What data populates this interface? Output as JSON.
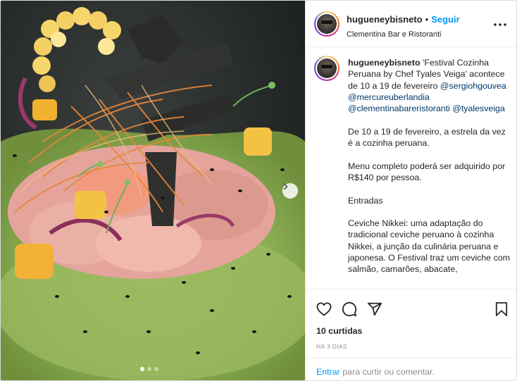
{
  "post": {
    "username": "hugueneybisneto",
    "bullet": "•",
    "follow_label": "Seguir",
    "location": "Clementina Bar e Ristoranti",
    "image_alt": "Prato de ceviche com milho, salmão, manga e molho verde",
    "carousel": {
      "count": 3,
      "active": 1
    }
  },
  "caption": {
    "username": "hugueneybisneto",
    "intro": "'Festival Cozinha Peruana by Chef Tyales Veiga' acontece de 10 a 19 de fevereiro",
    "mentions": [
      "@sergiohgouvea",
      "@mercureuberlandia",
      "@clementinabareristoranti",
      "@tyalesveiga"
    ],
    "paragraph_1": "De 10 a 19 de fevereiro, a estrela da vez é a cozinha peruana.",
    "paragraph_2": "Menu completo poderá ser adquirido por R$140 por pessoa.",
    "paragraph_3": "Entradas",
    "paragraph_4": "Ceviche Nikkei: uma adaptação do tradicional ceviche peruano à cozinha Nikkei, a junção da culinária peruana e japonesa. O Festival traz um ceviche com salmão, camarões, abacate,"
  },
  "stats": {
    "likes": "10 curtidas",
    "date": "HÁ 3 DIAS"
  },
  "comment_bar": {
    "login_label": "Entrar",
    "rest_label": "para curtir ou comentar."
  },
  "icons": {
    "more": "more-options-icon",
    "like": "heart-icon",
    "comment": "comment-icon",
    "share": "share-icon",
    "save": "bookmark-icon",
    "next": "chevron-right-icon"
  },
  "colors": {
    "link_blue": "#0095f6",
    "mention_blue": "#00376b",
    "text": "#262626",
    "muted": "#8e8e8e",
    "border": "#dbdbdb"
  }
}
